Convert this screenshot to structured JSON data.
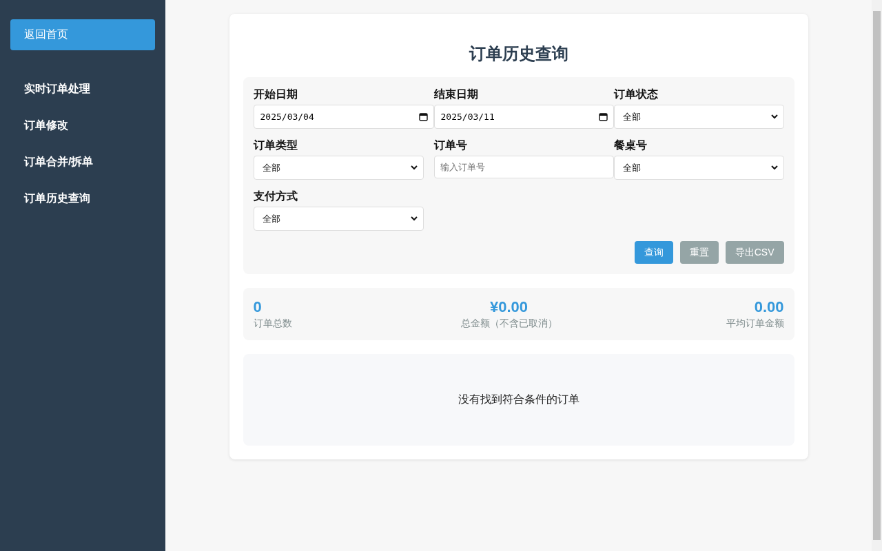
{
  "sidebar": {
    "items": [
      {
        "label": "返回首页",
        "kind": "home"
      },
      {
        "label": "实时订单处理",
        "kind": "link"
      },
      {
        "label": "订单修改",
        "kind": "link"
      },
      {
        "label": "订单合并/拆单",
        "kind": "link"
      },
      {
        "label": "订单历史查询",
        "kind": "link"
      }
    ]
  },
  "page": {
    "title": "订单历史查询"
  },
  "filters": [
    {
      "label": "开始日期",
      "kind": "date",
      "value": "2025/03/04"
    },
    {
      "label": "结束日期",
      "kind": "date",
      "value": "2025/03/11"
    },
    {
      "label": "订单状态",
      "kind": "select",
      "value": "全部"
    },
    {
      "label": "订单类型",
      "kind": "select",
      "value": "全部"
    },
    {
      "label": "订单号",
      "kind": "text",
      "placeholder": "输入订单号"
    },
    {
      "label": "餐桌号",
      "kind": "select",
      "value": "全部"
    },
    {
      "label": "支付方式",
      "kind": "select",
      "value": "全部"
    }
  ],
  "actions": [
    {
      "label": "查询",
      "kind": "primary"
    },
    {
      "label": "重置",
      "kind": "secondary"
    },
    {
      "label": "导出CSV",
      "kind": "secondary"
    }
  ],
  "stats": [
    {
      "value": "0",
      "label": "订单总数"
    },
    {
      "value": "¥0.00",
      "label": "总金额（不含已取消）"
    },
    {
      "value": "0.00",
      "label": "平均订单金额"
    }
  ],
  "results": {
    "empty_message": "没有找到符合条件的订单"
  }
}
